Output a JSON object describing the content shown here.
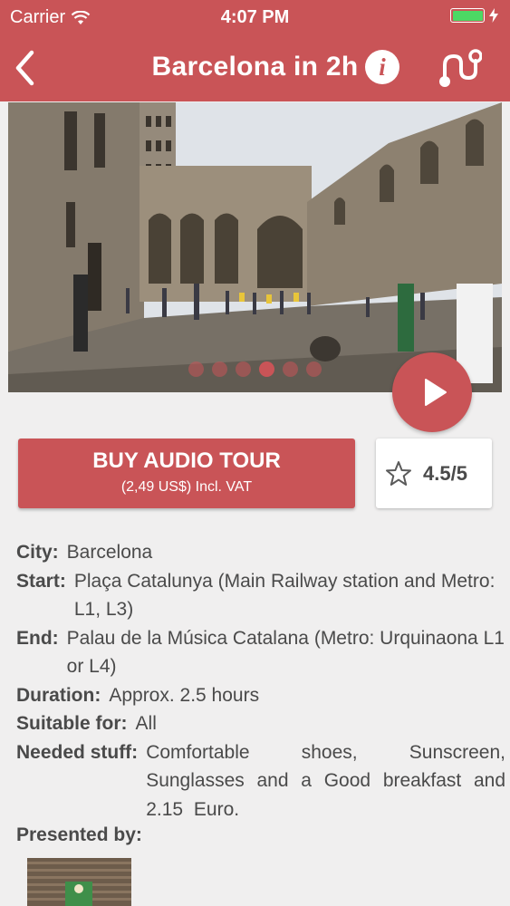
{
  "status_bar": {
    "carrier": "Carrier",
    "time": "4:07 PM",
    "battery_color": "#4cd964"
  },
  "nav": {
    "title": "Barcelona in 2h",
    "info_icon": "i",
    "back_icon": "chevron-left-icon",
    "route_icon": "route-icon"
  },
  "hero": {
    "image": "photo of a medieval stone square in Barcelona with tourists",
    "page_count": 6,
    "active_index": 3
  },
  "buy": {
    "label": "BUY AUDIO TOUR",
    "price": "(2,49 US$) Incl. VAT"
  },
  "rating": {
    "value": "4.5/5",
    "score": 4.5
  },
  "details": {
    "city": {
      "label": "City:",
      "value": "Barcelona"
    },
    "start": {
      "label": "Start:",
      "value": "Plaça Catalunya (Main Railway station and Metro: L1, L3)"
    },
    "end": {
      "label": "End:",
      "value": "Palau de la Música Catalana (Metro: Urquinaona L1 or L4)"
    },
    "duration": {
      "label": "Duration:",
      "value": "Approx. 2.5 hours"
    },
    "suitable": {
      "label": "Suitable for:",
      "value": "All"
    },
    "needed": {
      "label": "Needed stuff:",
      "value": "Comfortable shoes, Sunscreen, Sunglasses and a Good breakfast and 2.15 Euro."
    }
  },
  "presented_by": {
    "label": "Presented by:"
  },
  "colors": {
    "accent": "#c95457",
    "text": "#4a4a4a",
    "background": "#f0efef"
  }
}
